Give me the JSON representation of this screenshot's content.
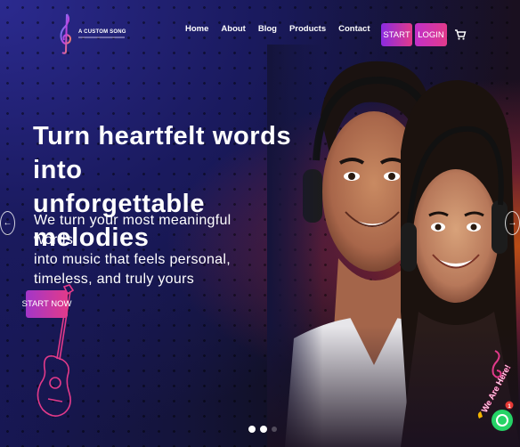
{
  "header": {
    "logo_name": "A CUSTOM SONG",
    "nav": [
      "Home",
      "About",
      "Blog",
      "Products",
      "Contact"
    ],
    "start_label": "START",
    "login_label": "LOGIN",
    "cart_icon": "cart-icon"
  },
  "hero": {
    "headline_line1": "Turn heartfelt words into",
    "headline_line2": "unforgettable melodies",
    "subtext_line1": "We turn your most meaningful words",
    "subtext_line2": "into music that feels personal,",
    "subtext_line3": "timeless, and truly yours",
    "cta_label": "START NOW",
    "prev_arrow": "←",
    "next_arrow": "→",
    "slides_total": 3,
    "slide_active": 1
  },
  "chat_widget": {
    "label": "We Are Here!",
    "badge_count": "1"
  },
  "colors": {
    "accent_start": "#8a2be2",
    "accent_end": "#e23a8a",
    "background": "#14143a"
  }
}
